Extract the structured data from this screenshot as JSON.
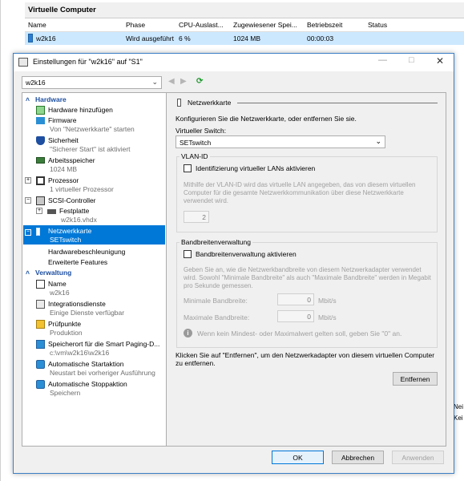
{
  "vm_list": {
    "title": "Virtuelle Computer",
    "columns": [
      "Name",
      "Phase",
      "CPU-Auslast...",
      "Zugewiesener Spei...",
      "Betriebszeit",
      "Status"
    ],
    "row": {
      "name": "w2k16",
      "phase": "Wird ausgeführt",
      "cpu": "6 %",
      "memory": "1024 MB",
      "uptime": "00:00:03",
      "status": ""
    }
  },
  "side_text": [
    "Nei",
    "Kei"
  ],
  "dialog": {
    "title": "Einstellungen für \"w2k16\" auf \"S1\"",
    "vm_select": "w2k16",
    "tree": {
      "hardware_header": "Hardware",
      "add_hardware": "Hardware hinzufügen",
      "firmware": "Firmware",
      "firmware_sub": "Von \"Netzwerkkarte\" starten",
      "security": "Sicherheit",
      "security_sub": "\"Sicherer Start\" ist aktiviert",
      "memory": "Arbeitsspeicher",
      "memory_sub": "1024 MB",
      "processor": "Prozessor",
      "processor_sub": "1 virtueller Prozessor",
      "scsi": "SCSI-Controller",
      "disk": "Festplatte",
      "disk_sub": "w2k16.vhdx",
      "nic": "Netzwerkkarte",
      "nic_sub": "SETswitch",
      "hw_accel": "Hardwarebeschleunigung",
      "adv_features": "Erweiterte Features",
      "mgmt_header": "Verwaltung",
      "name": "Name",
      "name_sub": "w2k16",
      "integration": "Integrationsdienste",
      "integration_sub": "Einige Dienste verfügbar",
      "checkpoints": "Prüfpunkte",
      "checkpoints_sub": "Produktion",
      "smart_paging": "Speicherort für die Smart Paging-D...",
      "smart_paging_sub": "c:\\vm\\w2k16\\w2k16",
      "auto_start": "Automatische Startaktion",
      "auto_start_sub": "Neustart bei vorheriger Ausführung",
      "auto_stop": "Automatische Stoppaktion",
      "auto_stop_sub": "Speichern"
    },
    "panel": {
      "heading": "Netzwerkkarte",
      "intro": "Konfigurieren Sie die Netzwerkkarte, oder entfernen Sie sie.",
      "switch_label": "Virtueller Switch:",
      "switch_value": "SETswitch",
      "vlan_group": "VLAN-ID",
      "vlan_checkbox": "Identifizierung virtueller LANs aktivieren",
      "vlan_help": "Mithilfe der VLAN-ID wird das virtuelle LAN angegeben, das von diesem virtuellen Computer für die gesamte Netzwerkkommunikation über diese Netzwerkkarte verwendet wird.",
      "vlan_value": "2",
      "bw_group": "Bandbreitenverwaltung",
      "bw_checkbox": "Bandbreitenverwaltung aktivieren",
      "bw_help": "Geben Sie an, wie die Netzwerkbandbreite von diesem Netzwerkadapter verwendet wird. Sowohl \"Minimale Bandbreite\" als auch \"Maximale Bandbreite\" werden in Megabit pro Sekunde gemessen.",
      "min_label": "Minimale Bandbreite:",
      "min_value": "0",
      "max_label": "Maximale Bandbreite:",
      "max_value": "0",
      "unit": "Mbit/s",
      "info": "Wenn kein Mindest- oder Maximalwert gelten soll, geben Sie \"0\" an.",
      "remove_text": "Klicken Sie auf \"Entfernen\", um den Netzwerkadapter von diesem virtuellen Computer zu entfernen.",
      "remove_button": "Entfernen"
    },
    "buttons": {
      "ok": "OK",
      "cancel": "Abbrechen",
      "apply": "Anwenden"
    }
  }
}
